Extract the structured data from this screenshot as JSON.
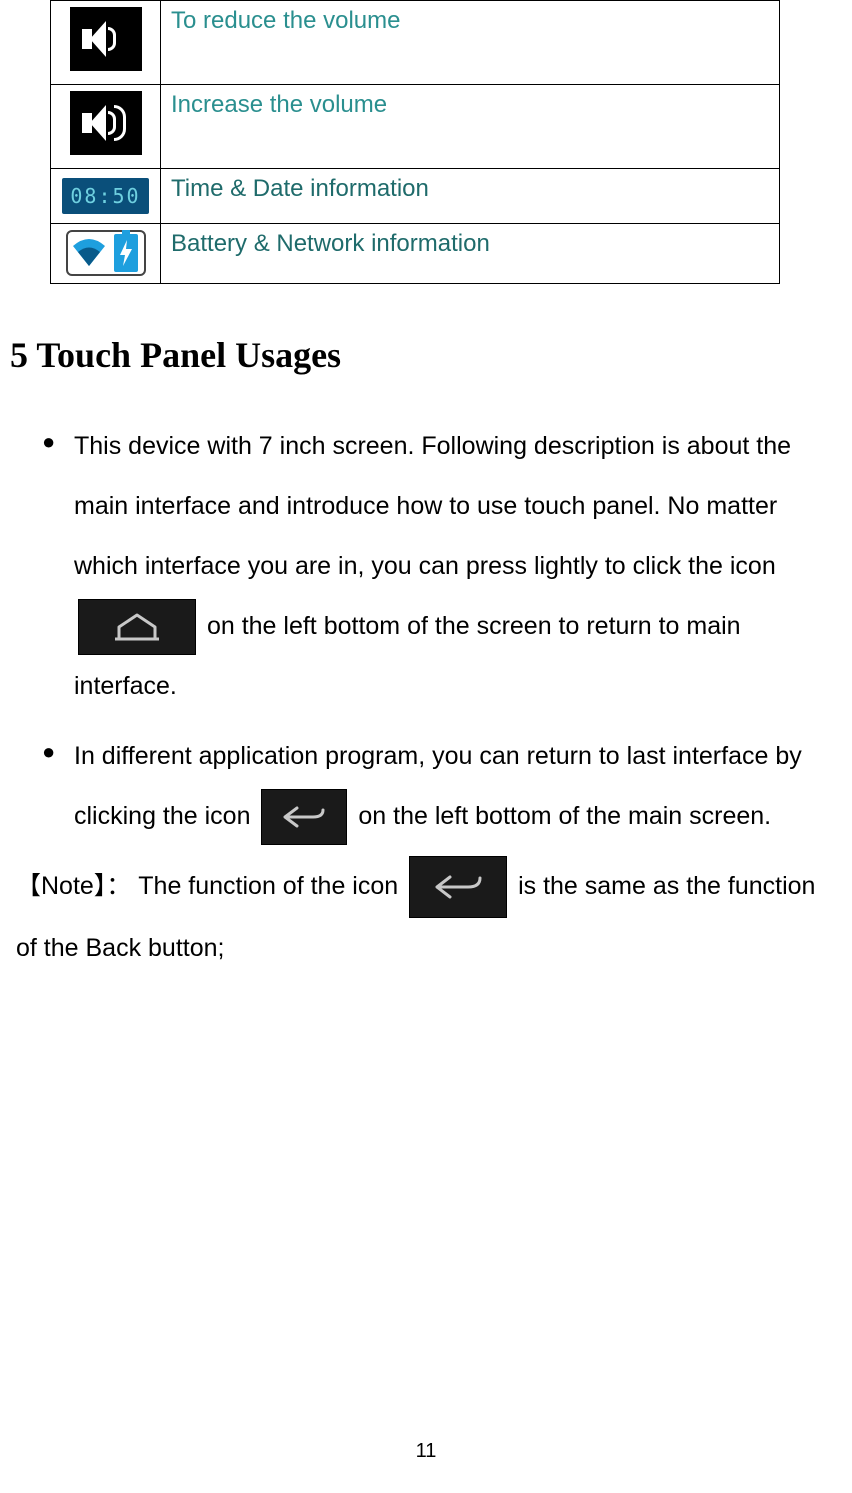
{
  "table": {
    "rows": [
      {
        "desc": "To reduce the volume"
      },
      {
        "desc": "Increase the volume"
      },
      {
        "desc": "Time & Date information",
        "clock": "08:50"
      },
      {
        "desc": "Battery & Network information"
      }
    ]
  },
  "heading": "5 Touch Panel Usages",
  "bullets": {
    "b1_part1": "This device with 7 inch screen. Following description is about the main interface and introduce how to use touch panel. No matter which interface you are in, you can press lightly to click the icon",
    "b1_part2": " on the left bottom of the screen to return to main interface.",
    "b2_part1": "In different application program, you can return to last interface by clicking the icon ",
    "b2_part2": "on the left bottom of the main screen."
  },
  "note": {
    "label": "【Note】：",
    "part1": "The function of the icon ",
    "part2": " is the same as the function of the Back button;"
  },
  "page_number": "11"
}
